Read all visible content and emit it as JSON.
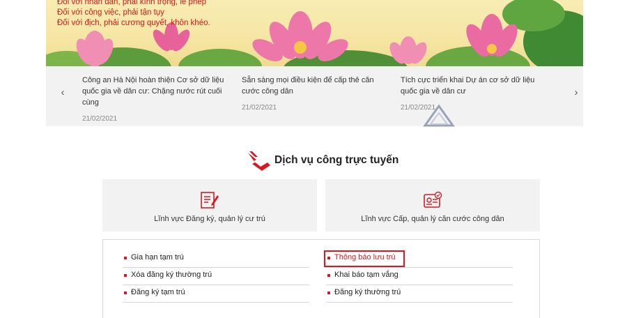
{
  "banner": {
    "lines": [
      "Đối với nhân dân, phải kính trọng, lễ phép",
      "Đối với công việc, phải tận tụy",
      "Đối với địch, phải cương quyết, khôn khéo."
    ]
  },
  "news": {
    "items": [
      {
        "title": "Công an Hà Nội hoàn thiện Cơ sở dữ liệu quốc gia về dân cư: Chặng nước rút cuối cùng",
        "date": "21/02/2021"
      },
      {
        "title": "Sẵn sàng mọi điều kiện để cấp thẻ căn cước công dân",
        "date": "21/02/2021"
      },
      {
        "title": "Tích cực triển khai Dự án cơ sở dữ liệu quốc gia về dân cư",
        "date": "21/02/2021"
      }
    ],
    "prev_icon": "chevron-left-icon",
    "next_icon": "chevron-right-icon"
  },
  "section": {
    "title": "Dịch vụ công trực tuyến"
  },
  "categories": [
    {
      "label": "Lĩnh vực Đăng ký, quản lý cư trú",
      "icon": "document-edit-icon"
    },
    {
      "label": "Lĩnh vực Cấp, quản lý căn cước công dân",
      "icon": "id-card-icon"
    }
  ],
  "services": {
    "left": [
      "Gia hạn tạm trú",
      "Xóa đăng ký thường trú",
      "Đăng ký tạm trú"
    ],
    "right": [
      "Thông báo lưu trú",
      "Khai báo tạm vắng",
      "Đăng ký thường trú"
    ]
  },
  "colors": {
    "accent": "#d71920",
    "banner_text": "#d0181c",
    "card_bg": "#f2f2f2"
  }
}
